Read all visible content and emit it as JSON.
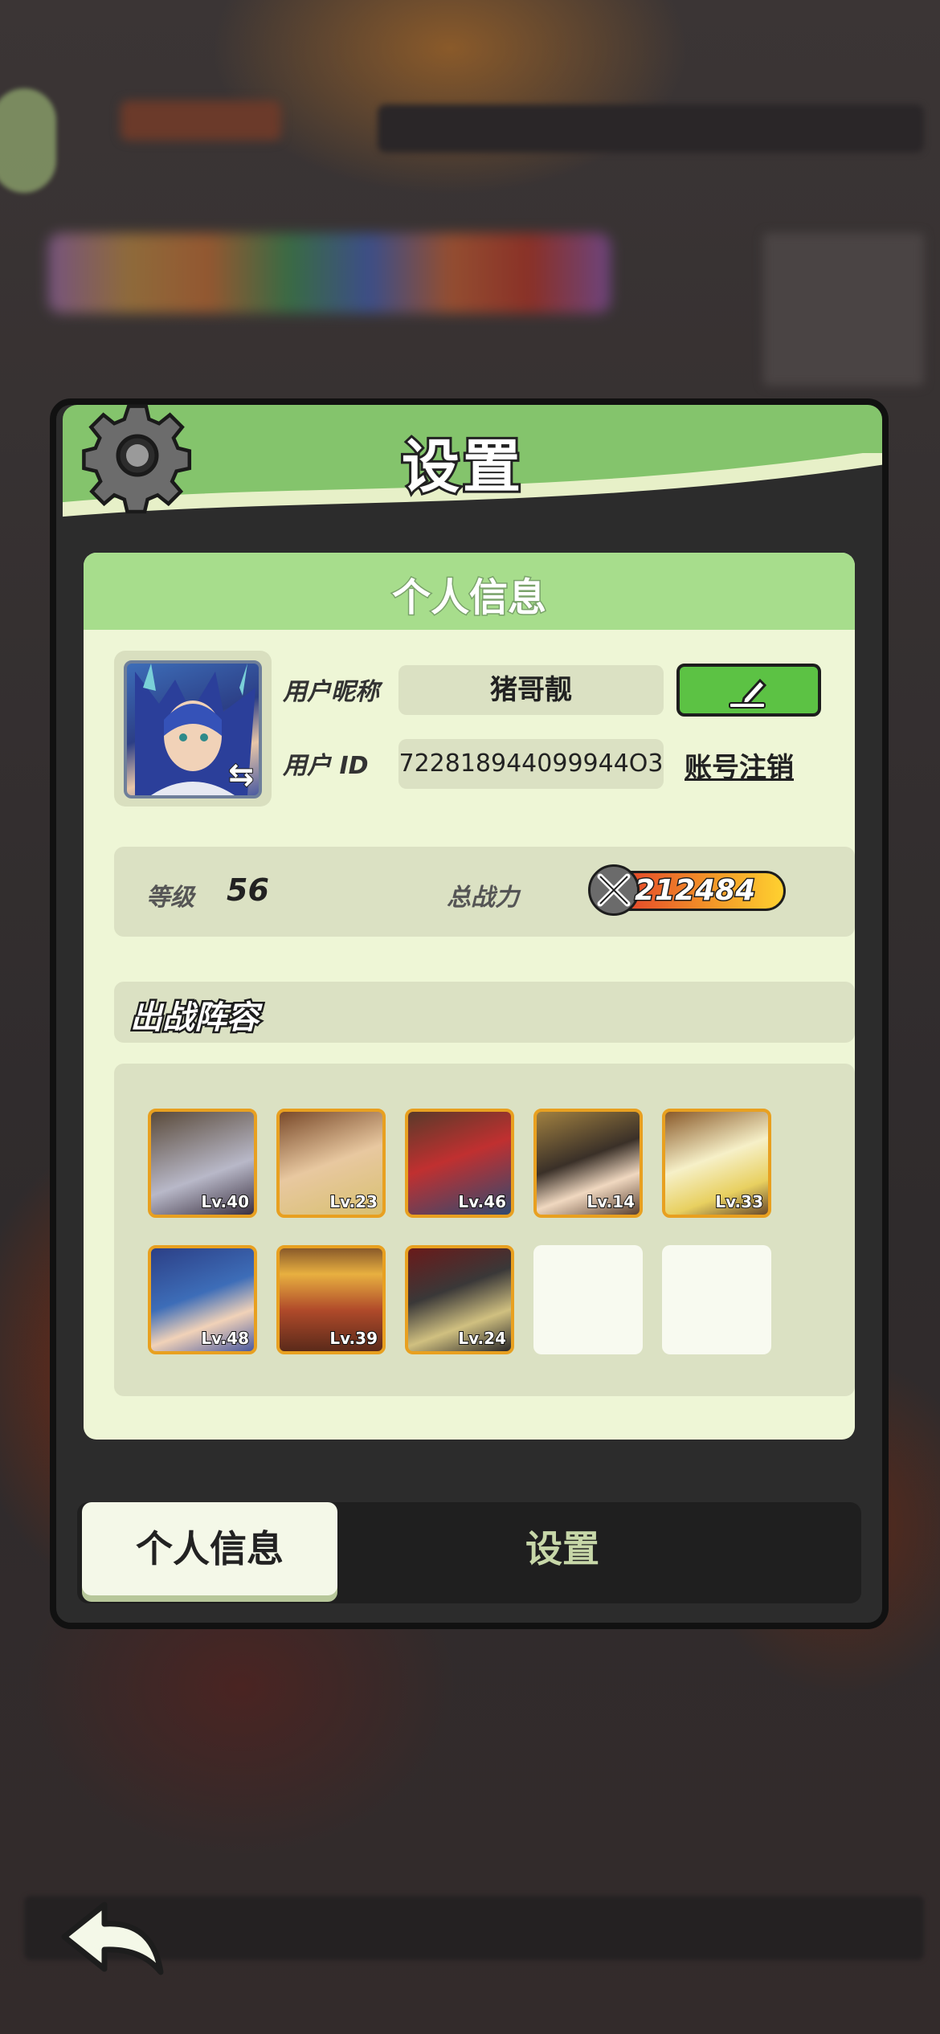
{
  "modal": {
    "title": "设置",
    "icon": "gear-icon"
  },
  "profile": {
    "section_title": "个人信息",
    "nickname_label": "用户昵称",
    "nickname_value": "猪哥靓",
    "id_label": "用户 ID",
    "id_value": "722818944099944O3",
    "edit_icon": "pencil-icon",
    "deregister_link": "账号注销",
    "swap_icon": "⇆"
  },
  "stats": {
    "level_label": "等级",
    "level_value": "56",
    "power_label": "总战力",
    "power_value": "212484"
  },
  "lineup": {
    "title": "出战阵容",
    "heroes": [
      {
        "level": "Lv.40",
        "color": "#6a5a70"
      },
      {
        "level": "Lv.23",
        "color": "#c8a070"
      },
      {
        "level": "Lv.46",
        "color": "#b03030"
      },
      {
        "level": "Lv.14",
        "color": "#6a5a40"
      },
      {
        "level": "Lv.33",
        "color": "#e8d890"
      },
      {
        "level": "Lv.48",
        "color": "#3d5db8"
      },
      {
        "level": "Lv.39",
        "color": "#a04a2a"
      },
      {
        "level": "Lv.24",
        "color": "#3a3838"
      }
    ],
    "empty_slots": 2
  },
  "tabs": [
    {
      "label": "个人信息",
      "active": true
    },
    {
      "label": "设置",
      "active": false
    }
  ],
  "nav": {
    "back_icon": "back-arrow-icon"
  }
}
